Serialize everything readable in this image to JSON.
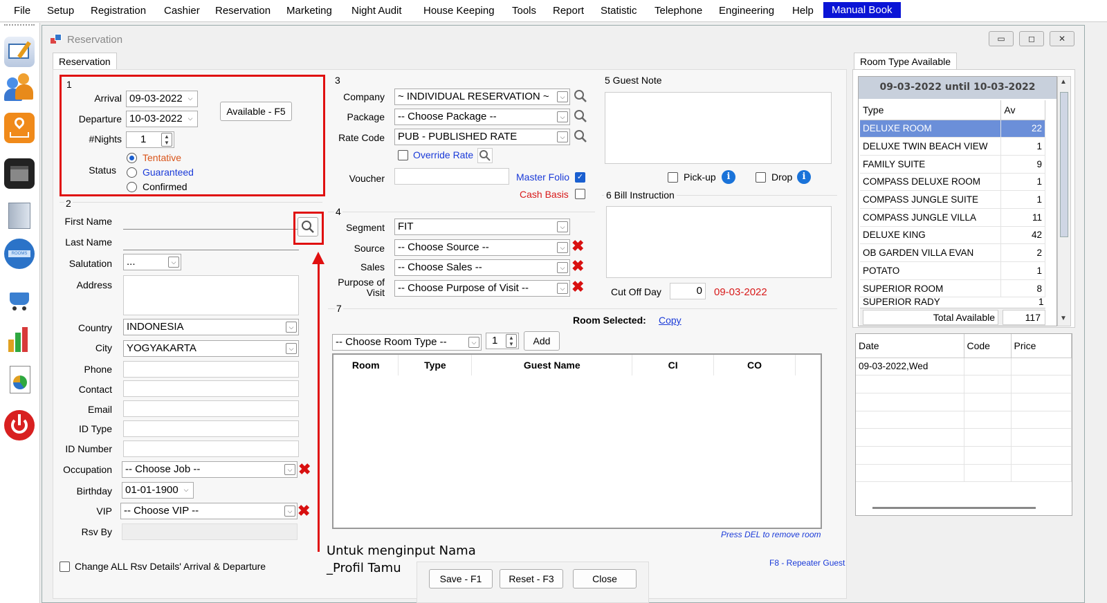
{
  "menu": [
    "File",
    "Setup",
    "Registration",
    "Cashier",
    "Reservation",
    "Marketing",
    "Night Audit",
    "House Keeping",
    "Tools",
    "Report",
    "Statistic",
    "Telephone",
    "Engineering",
    "Help",
    "Manual Book"
  ],
  "window": {
    "title": "Reservation"
  },
  "tabs": {
    "left": "Reservation",
    "right": "Room Type Available"
  },
  "section1": {
    "num": "1",
    "arrival_label": "Arrival",
    "arrival": "09-03-2022",
    "departure_label": "Departure",
    "departure": "10-03-2022",
    "nights_label": "#Nights",
    "nights": "1",
    "available_btn": "Available - F5",
    "status_label": "Status",
    "status": [
      "Tentative",
      "Guaranteed",
      "Confirmed"
    ]
  },
  "section2": {
    "num": "2",
    "first_name": "First Name",
    "last_name": "Last Name",
    "salutation": "Salutation",
    "salutation_value": "...",
    "address": "Address",
    "country": "Country",
    "country_value": "INDONESIA",
    "city": "City",
    "city_value": "YOGYAKARTA",
    "phone": "Phone",
    "contact": "Contact",
    "email": "Email",
    "id_type": "ID Type",
    "id_number": "ID Number",
    "occupation": "Occupation",
    "occupation_value": "-- Choose Job --",
    "birthday": "Birthday",
    "birthday_value": "01-01-1900",
    "vip": "VIP",
    "vip_value": "-- Choose VIP --",
    "rsv_by": "Rsv By"
  },
  "section3": {
    "num": "3",
    "company": "Company",
    "company_value": "~ INDIVIDUAL RESERVATION ~",
    "package": "Package",
    "package_value": "-- Choose Package --",
    "rate_code": "Rate Code",
    "rate_code_value": "PUB - PUBLISHED RATE",
    "override_rate": "Override Rate",
    "voucher": "Voucher",
    "master_folio": "Master Folio",
    "cash_basis": "Cash Basis"
  },
  "section4": {
    "num": "4",
    "segment": "Segment",
    "segment_value": "FIT",
    "source": "Source",
    "source_value": "-- Choose Source --",
    "sales": "Sales",
    "sales_value": "-- Choose Sales --",
    "purpose": "Purpose of",
    "purpose2": "Visit",
    "purpose_value": "-- Choose Purpose of Visit --"
  },
  "section5": {
    "label": "5 Guest Note",
    "pickup": "Pick-up",
    "drop": "Drop"
  },
  "section6": {
    "label": "6 Bill Instruction",
    "cutoff": "Cut Off Day",
    "cutoff_value": "0",
    "cutoff_date": "09-03-2022"
  },
  "section7": {
    "num": "7",
    "room_selected": "Room Selected:",
    "copy": "Copy",
    "room_type_value": "-- Choose Room Type --",
    "qty": "1",
    "add": "Add",
    "columns": [
      "Room",
      "Type",
      "Guest Name",
      "CI",
      "CO"
    ],
    "hint": "Press DEL to remove room"
  },
  "room_avail": {
    "period": "09-03-2022 until 10-03-2022",
    "col_type": "Type",
    "col_av": "Av",
    "rows": [
      {
        "type": "DELUXE ROOM",
        "av": "22"
      },
      {
        "type": "DELUXE TWIN BEACH VIEW",
        "av": "1"
      },
      {
        "type": "FAMILY SUITE",
        "av": "9"
      },
      {
        "type": "COMPASS DELUXE ROOM",
        "av": "1"
      },
      {
        "type": "COMPASS JUNGLE SUITE",
        "av": "1"
      },
      {
        "type": "COMPASS JUNGLE VILLA",
        "av": "11"
      },
      {
        "type": "DELUXE KING",
        "av": "42"
      },
      {
        "type": "OB GARDEN VILLA EVAN",
        "av": "2"
      },
      {
        "type": "POTATO",
        "av": "1"
      },
      {
        "type": "SUPERIOR ROOM",
        "av": "8"
      },
      {
        "type": "SUPERIOR RADY",
        "av": "1"
      }
    ],
    "total_label": "Total Available",
    "total": "117"
  },
  "rates": {
    "col_date": "Date",
    "col_code": "Code",
    "col_price": "Price",
    "row_date": "09-03-2022,Wed"
  },
  "footer": {
    "change_all": "Change ALL Rsv Details' Arrival & Departure",
    "repeater": "F8 - Repeater Guest",
    "save": "Save - F1",
    "reset": "Reset - F3",
    "close": "Close"
  },
  "annotation": {
    "line1": "Untuk menginput Nama",
    "line2": "_Profil Tamu"
  },
  "colors": {
    "accent": "#0a14d6",
    "highlight": "#e01010",
    "selected_row": "#6b8fd9"
  }
}
